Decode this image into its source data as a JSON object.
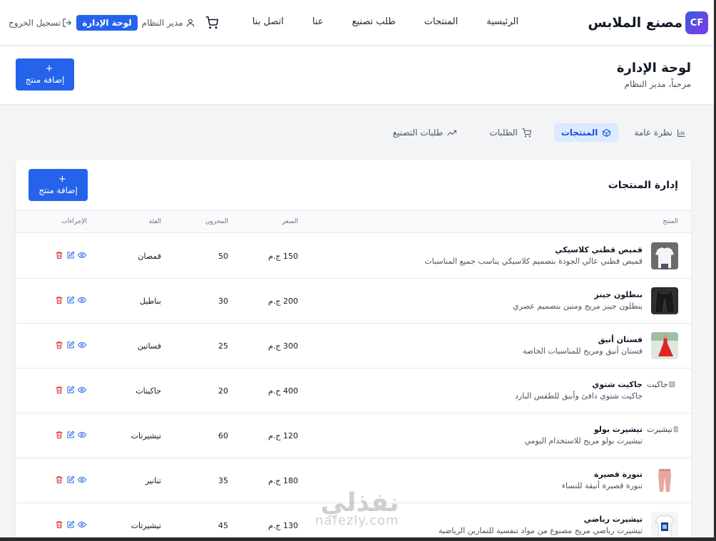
{
  "brand": {
    "logo": "CF",
    "name": "مصنع الملابس"
  },
  "nav": {
    "links": [
      "الرئيسية",
      "المنتجات",
      "طلب تصنيع",
      "عنا",
      "اتصل بنا"
    ],
    "cart_icon": "shopping-cart-icon",
    "user_icon": "user-icon",
    "user_label": "مدير النظام",
    "admin_button": "لوحة الإدارة",
    "logout_icon": "logout-icon",
    "logout_label": "تسجيل الخروج"
  },
  "header": {
    "title": "لوحة الإدارة",
    "subtitle": "مرحباً، مدير النظام",
    "add_plus": "+",
    "add_label": "إضافة منتج"
  },
  "tabs": [
    {
      "label": "نظرة عامة",
      "icon": "bar-chart-icon",
      "active": false
    },
    {
      "label": "المنتجات",
      "icon": "box-icon",
      "active": true
    },
    {
      "label": "الطلبات",
      "icon": "cart-icon",
      "active": false
    },
    {
      "label": "طلبات التصنيع",
      "icon": "trending-up-icon",
      "active": false
    }
  ],
  "products_section": {
    "title": "إدارة المنتجات",
    "add_plus": "+",
    "add_label": "إضافة منتج",
    "columns": {
      "product": "المنتج",
      "price": "السعر",
      "stock": "المخزون",
      "category": "الفئة",
      "actions": "الإجراءات"
    },
    "rows": [
      {
        "name": "قميص قطني كلاسيكي",
        "description": "قميص قطني عالي الجودة بتصميم كلاسيكي يناسب جميع المناسبات",
        "price": "150 ج.م",
        "stock": "50",
        "category": "قمصان",
        "image": "white-shirt",
        "alt": ""
      },
      {
        "name": "بنطلون جينز",
        "description": "بنطلون جينز مريح ومتين بتصميم عصري",
        "price": "200 ج.م",
        "stock": "30",
        "category": "بناطيل",
        "image": "dark-jeans",
        "alt": ""
      },
      {
        "name": "فستان أنيق",
        "description": "فستان أنيق ومريح للمناسبات الخاصة",
        "price": "300 ج.م",
        "stock": "25",
        "category": "فساتين",
        "image": "red-dress",
        "alt": ""
      },
      {
        "name": "جاكيت شتوي",
        "description": "جاكيت شتوي دافئ وأنيق للطقس البارد",
        "price": "400 ج.م",
        "stock": "20",
        "category": "جاكيتات",
        "image": "broken",
        "alt": "جاكيت"
      },
      {
        "name": "تيشيرت بولو",
        "description": "تيشيرت بولو مريح للاستخدام اليومي",
        "price": "120 ج.م",
        "stock": "60",
        "category": "تيشيرتات",
        "image": "broken",
        "alt": "تيشيرت"
      },
      {
        "name": "تنورة قصيرة",
        "description": "تنورة قصيرة أنيقة للنساء",
        "price": "180 ج.م",
        "stock": "35",
        "category": "تنانير",
        "image": "pink-pants",
        "alt": ""
      },
      {
        "name": "تيشيرت رياضي",
        "description": "تيشيرت رياضي مريح مصنوع من مواد تنفسية للتمارين الرياضية",
        "price": "130 ج.م",
        "stock": "45",
        "category": "تيشيرتات",
        "image": "sport-tee",
        "alt": ""
      }
    ],
    "action_icons": [
      "eye-icon",
      "edit-icon",
      "trash-icon"
    ]
  },
  "watermark": {
    "arabic": "نفذلي",
    "latin": "nafezly.com"
  },
  "colors": {
    "primary": "#2563eb",
    "active_tab_bg": "#dbeafe",
    "danger": "#dc2626",
    "brand_gradient_start": "#3b5bdb",
    "brand_gradient_end": "#7c3aed"
  }
}
